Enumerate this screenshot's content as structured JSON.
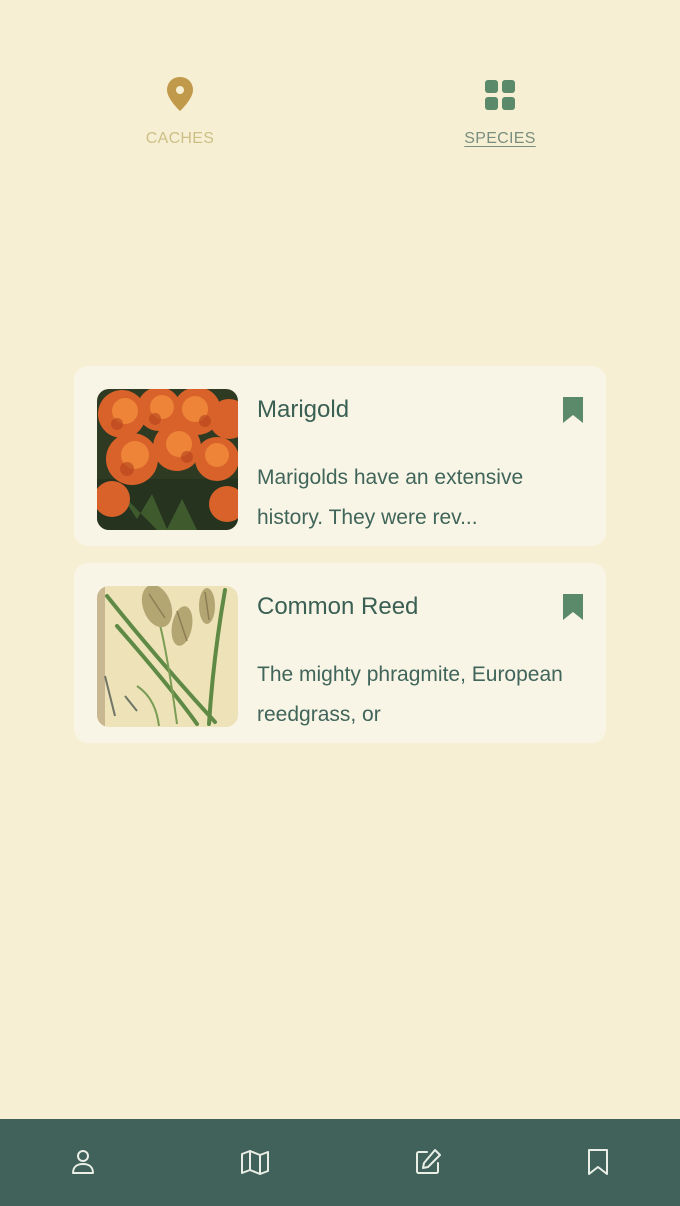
{
  "tabs": [
    {
      "label": "CACHES",
      "icon": "map-pin-icon",
      "active": false
    },
    {
      "label": "SPECIES",
      "icon": "grid-icon",
      "active": true
    }
  ],
  "species": [
    {
      "name": "Marigold",
      "description": "Marigolds have an extensive history. They were rev...",
      "image": "marigold-photo",
      "bookmarked": true
    },
    {
      "name": "Common Reed",
      "description": "The mighty phragmite, European reedgrass, or",
      "image": "common-reed-illustration",
      "bookmarked": true
    }
  ],
  "bottom_nav": [
    {
      "icon": "user-icon"
    },
    {
      "icon": "map-icon"
    },
    {
      "icon": "edit-icon"
    },
    {
      "icon": "bookmark-icon"
    }
  ],
  "colors": {
    "background": "#f6efd3",
    "card": "#f9f5e6",
    "accent_green": "#5b8a6a",
    "gold": "#c09a4a",
    "nav_bar": "#41625a"
  }
}
